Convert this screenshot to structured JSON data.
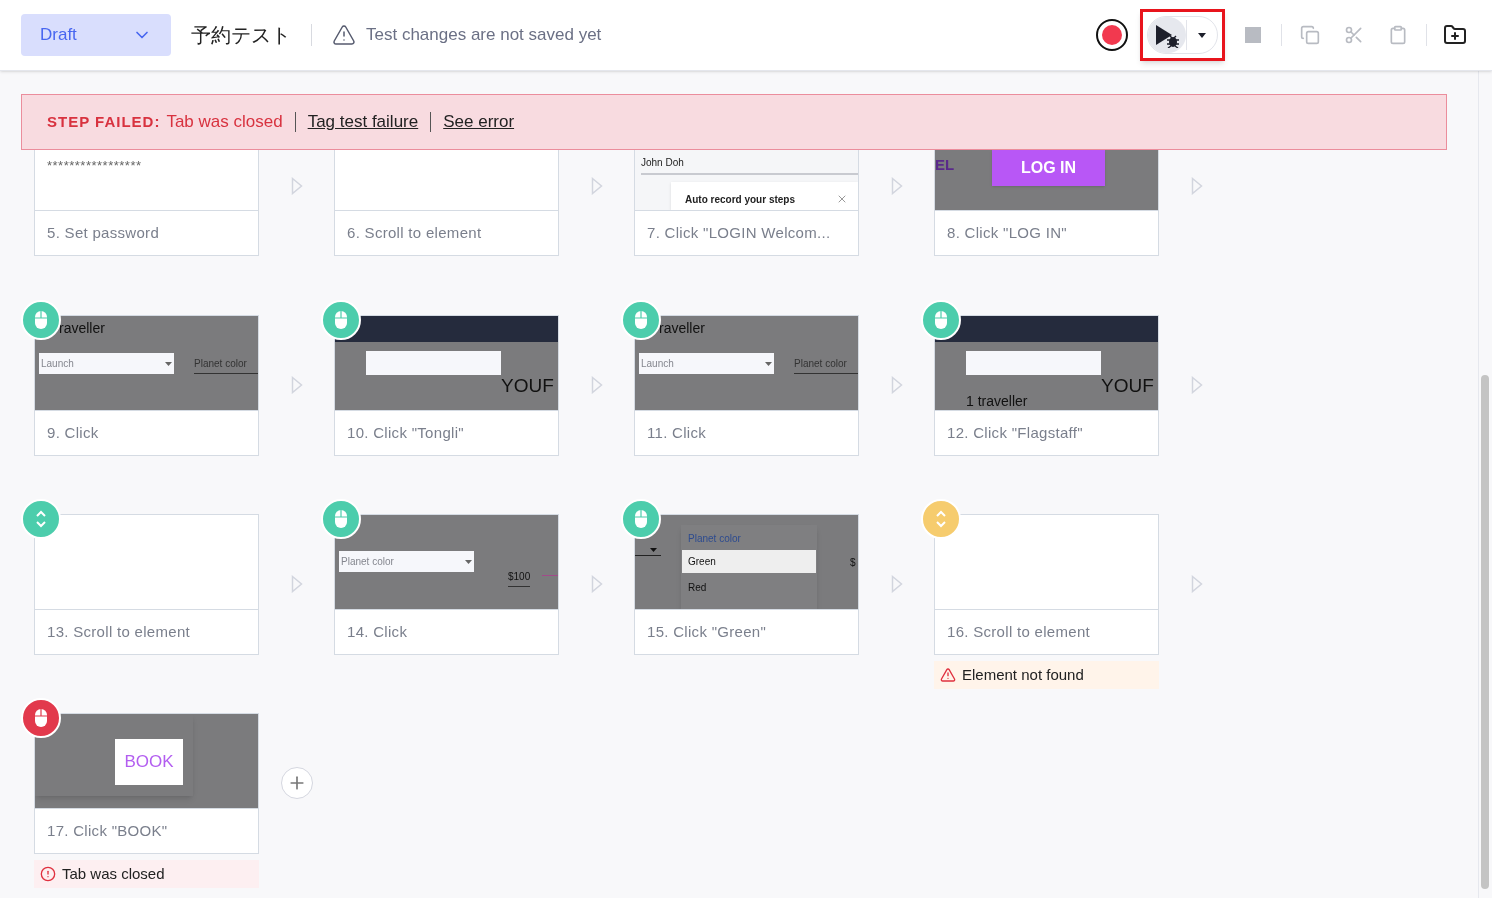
{
  "header": {
    "status": "Draft",
    "test_name": "予約テスト",
    "notice": "Test changes are not saved yet"
  },
  "toolbar": [
    {
      "kind": "record",
      "disabled": false
    },
    {
      "kind": "run-debug",
      "disabled": false,
      "highlighted": true
    },
    {
      "kind": "stop",
      "disabled": true
    },
    {
      "kind": "copy",
      "disabled": true
    },
    {
      "kind": "cut",
      "disabled": true
    },
    {
      "kind": "paste",
      "disabled": true
    },
    {
      "kind": "new-folder",
      "disabled": false
    }
  ],
  "banner": {
    "label": "STEP FAILED:",
    "message": "Tab was closed",
    "links": [
      "Tag test failure",
      "See error"
    ]
  },
  "steps": [
    {
      "label": "5. Set password",
      "thumb": {
        "kind": "password",
        "texts": [
          "*****************"
        ]
      }
    },
    {
      "label": "6. Scroll to element",
      "thumb": {
        "kind": "blank"
      }
    },
    {
      "label": "7. Click \"LOGIN Welcom...",
      "thumb": {
        "kind": "popup",
        "texts": [
          "John Doh",
          "Auto record your steps"
        ]
      }
    },
    {
      "label": "8. Click \"LOG IN\"",
      "thumb": {
        "kind": "login",
        "texts": [
          "EL",
          "LOG IN"
        ]
      }
    },
    {
      "label": "9. Click",
      "badge": {
        "kind": "mouse",
        "color": "#4ccdac"
      },
      "thumb": {
        "kind": "form",
        "texts": [
          "raveller",
          "Launch",
          "Planet color"
        ]
      }
    },
    {
      "label": "10. Click \"Tongli\"",
      "badge": {
        "kind": "mouse",
        "color": "#4ccdac"
      },
      "thumb": {
        "kind": "hero",
        "texts": [
          "YOUF"
        ]
      }
    },
    {
      "label": "11. Click",
      "badge": {
        "kind": "mouse",
        "color": "#4ccdac"
      },
      "thumb": {
        "kind": "form",
        "texts": [
          "raveller",
          "Launch",
          "Planet color"
        ]
      }
    },
    {
      "label": "12. Click \"Flagstaff\"",
      "badge": {
        "kind": "mouse",
        "color": "#4ccdac"
      },
      "thumb": {
        "kind": "hero",
        "texts": [
          "YOUF",
          "1 traveller"
        ]
      }
    },
    {
      "label": "13. Scroll to element",
      "badge": {
        "kind": "scroll",
        "color": "#4ccdac"
      },
      "thumb": {
        "kind": "blank"
      }
    },
    {
      "label": "14. Click",
      "badge": {
        "kind": "mouse",
        "color": "#4ccdac"
      },
      "thumb": {
        "kind": "price",
        "texts": [
          "Planet color",
          "$100"
        ]
      }
    },
    {
      "label": "15. Click \"Green\"",
      "badge": {
        "kind": "mouse",
        "color": "#4ccdac"
      },
      "thumb": {
        "kind": "menu",
        "texts": [
          "Planet color",
          "Green",
          "Red",
          "$"
        ]
      }
    },
    {
      "label": "16. Scroll to element",
      "badge": {
        "kind": "scroll",
        "color": "#f6cc6e"
      },
      "thumb": {
        "kind": "blank"
      },
      "note": {
        "kind": "warning",
        "text": "Element not found"
      }
    },
    {
      "label": "17. Click \"BOOK\"",
      "badge": {
        "kind": "mouse",
        "color": "#e2394c"
      },
      "thumb": {
        "kind": "book",
        "texts": [
          "BOOK"
        ]
      },
      "note": {
        "kind": "error",
        "text": "Tab was closed"
      }
    }
  ]
}
